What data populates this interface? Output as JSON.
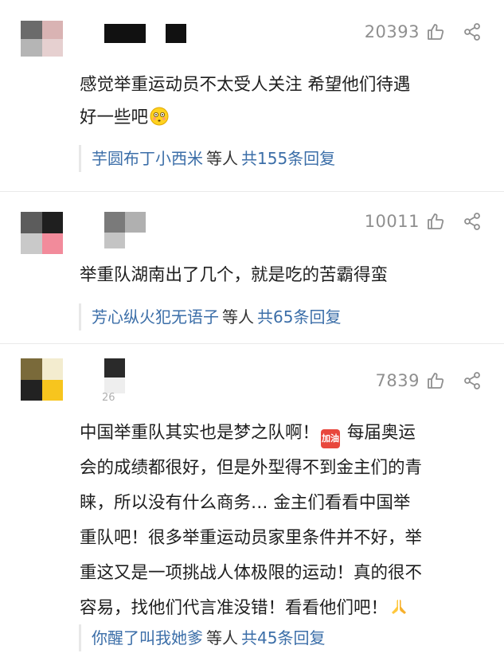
{
  "comments": [
    {
      "likes": "20393",
      "text_lines": [
        "感觉举重运动员不太受人关注 希望他们待遇",
        "好一些吧"
      ],
      "emoji": "flushed-face-emoji",
      "reply": {
        "user": "芋圆布丁小西米",
        "mid": "等人",
        "total": "共155条回复"
      }
    },
    {
      "likes": "10011",
      "text_lines": [
        "举重队湖南出了几个，就是吃的苦霸得蛮"
      ],
      "reply": {
        "user": "芳心纵火犯无语子",
        "mid": "等人",
        "total": "共65条回复"
      }
    },
    {
      "likes": "7839",
      "meta_fragment": "26",
      "text_lines": [
        "中国举重队其实也是梦之队啊！",
        " 每届奥运",
        "会的成绩都很好，但是外型得不到金主们的青",
        "睐，所以没有什么商务… 金主们看看中国举",
        "重队吧！很多举重运动员家里条件并不好，举",
        "重这又是一项挑战人体极限的运动！真的很不",
        "容易，找他们代言准没错！看看他们吧！"
      ],
      "emoji_sticker": "加油",
      "reply": {
        "user": "你醒了叫我她爹",
        "mid": "等人",
        "total": "共45条回复"
      }
    }
  ],
  "icons": {
    "like": "thumbs-up-icon",
    "share": "share-icon",
    "pray": "folded-hands-emoji"
  },
  "colors": {
    "link": "#3b6ea8",
    "meta": "#8f8f8f",
    "reply_border": "#e8e8e8"
  }
}
